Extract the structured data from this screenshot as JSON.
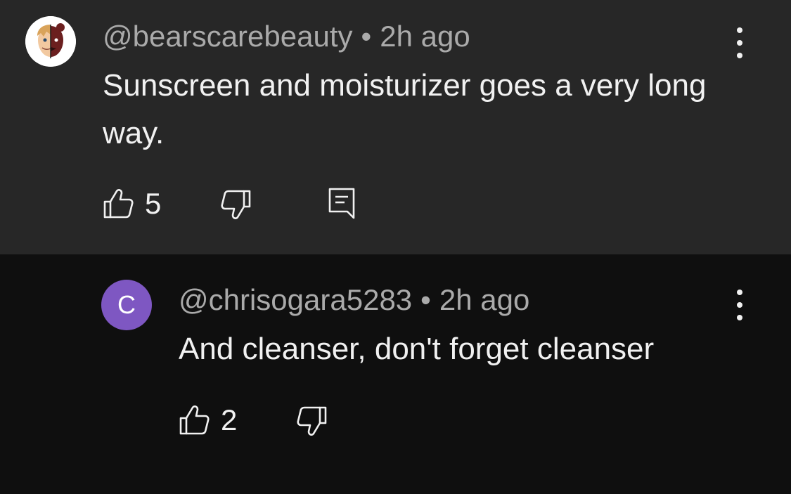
{
  "comments": [
    {
      "author": "@bearscarebeauty",
      "separator": "•",
      "time": "2h ago",
      "text": "Sunscreen and moisturizer goes a very long way.",
      "likes": "5"
    },
    {
      "avatar_letter": "C",
      "author": "@chrisogara5283",
      "separator": "•",
      "time": "2h ago",
      "text": "And cleanser, don't forget cleanser",
      "likes": "2"
    }
  ],
  "colors": {
    "top_background": "#272727",
    "reply_background": "#0f0f0f",
    "avatar_reply": "#7e57c2",
    "meta_text": "#aaaaaa",
    "body_text": "#f1f1f1"
  },
  "icons": {
    "like": "thumbs-up-icon",
    "dislike": "thumbs-down-icon",
    "reply": "comment-reply-icon",
    "more": "more-vertical-icon"
  }
}
